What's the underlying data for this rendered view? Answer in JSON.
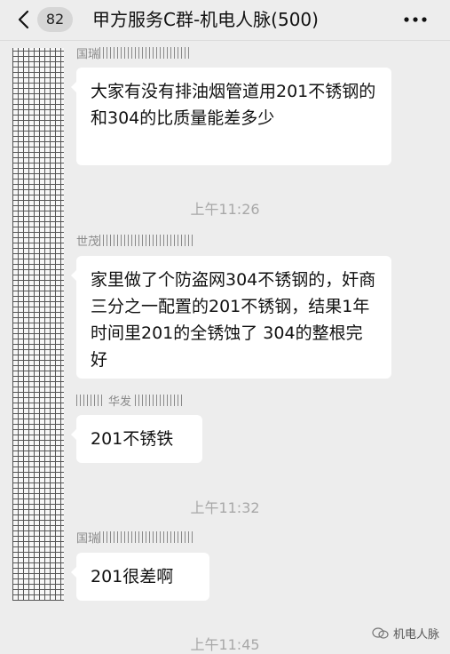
{
  "header": {
    "badge": "82",
    "title": "甲方服务C群-机电人脉(500)"
  },
  "messages": [
    {
      "sender": "国瑞",
      "text": "大家有没有排油烟管道用201不锈钢的  和304的比质量能差多少"
    },
    {
      "sender": "世茂",
      "text": "家里做了个防盗网304不锈钢的，奸商三分之一配置的201不锈钢，结果1年时间里201的全锈蚀了  304的整根完好"
    },
    {
      "sender": "华发",
      "text": "201不锈铁"
    },
    {
      "sender": "国瑞",
      "text": "201很差啊"
    }
  ],
  "timestamps": [
    "上午11:26",
    "上午11:32",
    "上午11:45"
  ],
  "watermark": "机电人脉",
  "colors": {
    "background": "#ededed",
    "bubble": "#ffffff",
    "meta_text": "#a8a8a8"
  }
}
